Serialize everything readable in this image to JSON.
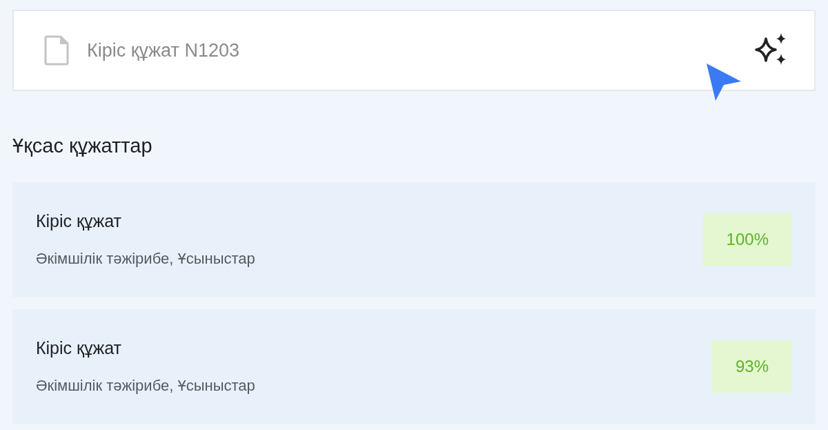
{
  "search": {
    "placeholder": "Кіріс құжат N1203"
  },
  "section_title": "Ұқсас құжаттар",
  "documents": [
    {
      "title": "Кіріс құжат",
      "tags": "Әкімшілік тәжірибе, Ұсыныстар",
      "match": "100%"
    },
    {
      "title": "Кіріс құжат",
      "tags": "Әкімшілік тәжірибе, Ұсыныстар",
      "match": "93%"
    }
  ]
}
